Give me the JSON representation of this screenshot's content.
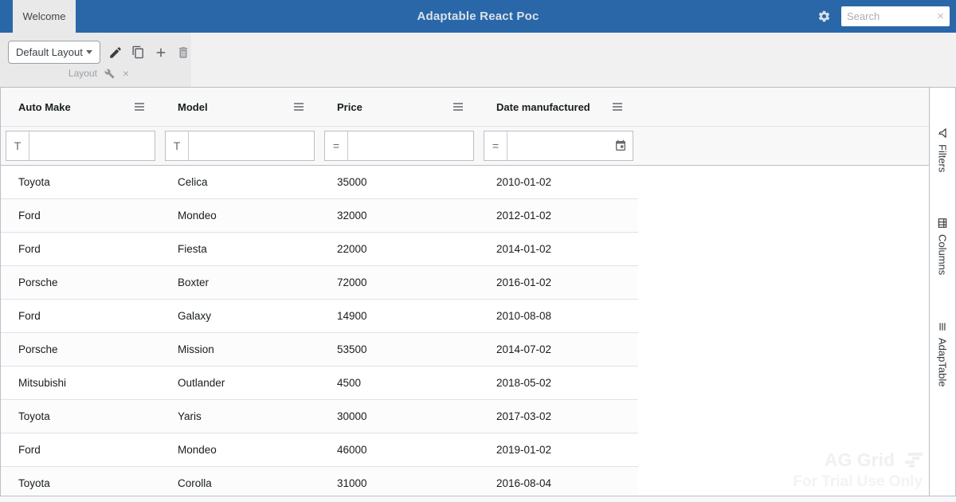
{
  "header": {
    "tab_label": "Welcome",
    "title": "Adaptable React Poc",
    "search_placeholder": "Search",
    "search_value": "",
    "clear_glyph": "×"
  },
  "toolbar": {
    "layout_value": "Default Layout",
    "group_label": "Layout",
    "close_glyph": "×",
    "icons": [
      "edit-pencil-icon",
      "clone-icon",
      "add-plus-icon",
      "delete-trash-icon",
      "wrench-icon"
    ]
  },
  "grid": {
    "columns": [
      {
        "label": "Auto Make",
        "filter": "text",
        "filter_glyph": "T"
      },
      {
        "label": "Model",
        "filter": "text",
        "filter_glyph": "T"
      },
      {
        "label": "Price",
        "filter": "number",
        "filter_glyph": "="
      },
      {
        "label": "Date manufactured",
        "filter": "date",
        "filter_glyph": "="
      }
    ],
    "filter_values": [
      "",
      "",
      "",
      ""
    ],
    "rows": [
      [
        "Toyota",
        "Celica",
        "35000",
        "2010-01-02"
      ],
      [
        "Ford",
        "Mondeo",
        "32000",
        "2012-01-02"
      ],
      [
        "Ford",
        "Fiesta",
        "22000",
        "2014-01-02"
      ],
      [
        "Porsche",
        "Boxter",
        "72000",
        "2016-01-02"
      ],
      [
        "Ford",
        "Galaxy",
        "14900",
        "2010-08-08"
      ],
      [
        "Porsche",
        "Mission",
        "53500",
        "2014-07-02"
      ],
      [
        "Mitsubishi",
        "Outlander",
        "4500",
        "2018-05-02"
      ],
      [
        "Toyota",
        "Yaris",
        "30000",
        "2017-03-02"
      ],
      [
        "Ford",
        "Mondeo",
        "46000",
        "2019-01-02"
      ],
      [
        "Toyota",
        "Corolla",
        "31000",
        "2016-08-04"
      ]
    ]
  },
  "sidebar": {
    "tabs": [
      {
        "label": "Filters",
        "icon": "filter-funnel-icon"
      },
      {
        "label": "Columns",
        "icon": "columns-icon"
      },
      {
        "label": "AdapTable",
        "icon": "menu-bars-icon"
      }
    ]
  },
  "watermark": {
    "title": "AG Grid",
    "subtitle": "For Trial Use Only"
  },
  "colors": {
    "header_bar": "#2a67a8",
    "grid_border": "#babfc7",
    "row_border": "#dde2eb",
    "row_alt_bg": "#fcfcfc",
    "grid_header_bg": "#f8f8f8",
    "panel_bg": "#e9e9e9",
    "strip_bg": "#f1f1f1"
  }
}
